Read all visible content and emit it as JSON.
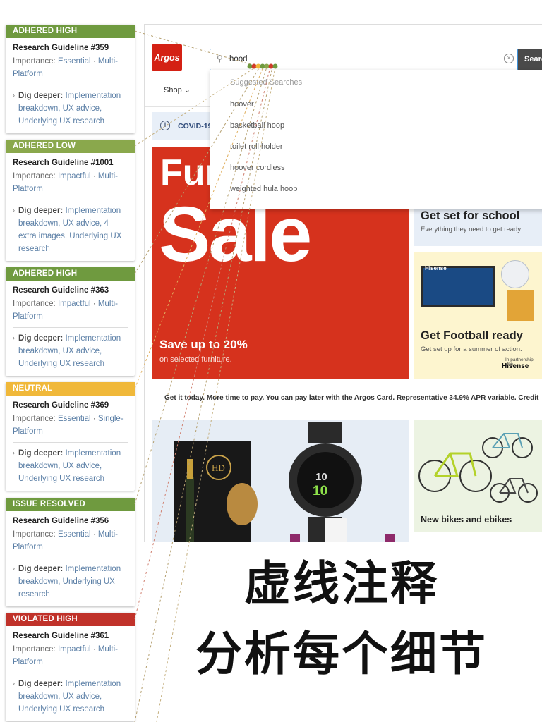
{
  "colors": {
    "adhered_high": "#6f9a3f",
    "adhered_low": "#8aa84c",
    "neutral": "#f0b83a",
    "issue_resolved": "#6f9a3f",
    "violated_high": "#c0322a",
    "argos_red": "#d42114",
    "link_blue": "#5b7fa6"
  },
  "cards": [
    {
      "status": "ADHERED HIGH",
      "title": "Research Guideline #359",
      "imp_label": "Importance:",
      "imp_a": "Essential",
      "imp_b": "Multi-Platform",
      "dig_label": "Dig deeper:",
      "dig_text": "Implementation breakdown, UX advice, Underlying UX research"
    },
    {
      "status": "ADHERED LOW",
      "title": "Research Guideline #1001",
      "imp_label": "Importance:",
      "imp_a": "Impactful",
      "imp_b": "Multi-Platform",
      "dig_label": "Dig deeper:",
      "dig_text": "Implementation breakdown, UX advice, 4 extra images, Underlying UX research"
    },
    {
      "status": "ADHERED HIGH",
      "title": "Research Guideline #363",
      "imp_label": "Importance:",
      "imp_a": "Impactful",
      "imp_b": "Multi-Platform",
      "dig_label": "Dig deeper:",
      "dig_text": "Implementation breakdown, UX advice, Underlying UX research"
    },
    {
      "status": "NEUTRAL",
      "title": "Research Guideline #369",
      "imp_label": "Importance:",
      "imp_a": "Essential",
      "imp_b": "Single-Platform",
      "dig_label": "Dig deeper:",
      "dig_text": "Implementation breakdown, UX advice, Underlying UX research"
    },
    {
      "status": "ISSUE RESOLVED",
      "title": "Research Guideline #356",
      "imp_label": "Importance:",
      "imp_a": "Essential",
      "imp_b": "Multi-Platform",
      "dig_label": "Dig deeper:",
      "dig_text": "Implementation breakdown, Underlying UX research"
    },
    {
      "status": "VIOLATED HIGH",
      "title": "Research Guideline #361",
      "imp_label": "Importance:",
      "imp_a": "Impactful",
      "imp_b": "Multi-Platform",
      "dig_label": "Dig deeper:",
      "dig_text": "Implementation breakdown, UX advice, Underlying UX research"
    }
  ],
  "site": {
    "logo": "Argos",
    "search_value": "hood",
    "search_button": "Search",
    "nav_shop": "Shop",
    "dropdown_header": "Suggested Searches",
    "suggestions": [
      "hoover",
      "basketball hoop",
      "toilet roll holder",
      "hoover cordless",
      "weighted hula hoop"
    ],
    "covid_text": "COVID-19",
    "sale_fur": "Fur",
    "sale_big": "Sale",
    "sale_save": "Save up to 20%",
    "sale_selected": "on selected furniture.",
    "school_title": "Get set for school",
    "school_sub": "Everything they need to get ready.",
    "tv_brand": "Hisense",
    "football_title": "Get Football ready",
    "football_sub": "Get set up for a summer of action.",
    "partnership": "In partnership with",
    "partner": "Hisense",
    "credit_line": "Get it today. More time to pay. You can pay later with the Argos Card. Representative 34.9% APR variable. Credit",
    "bikes_title": "New bikes and ebikes",
    "watch_top": "10",
    "watch_main": "10"
  },
  "caption": {
    "line1": "虚线注释",
    "line2": "分析每个细节"
  }
}
